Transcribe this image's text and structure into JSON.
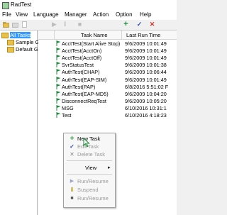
{
  "window": {
    "title": "RadTest"
  },
  "menu": [
    "File",
    "View",
    "Language",
    "Manager",
    "Action",
    "Option",
    "Help"
  ],
  "toolbar": {
    "icons": [
      "folder-icon",
      "folder-open-icon",
      "page-icon",
      "skip-icon",
      "pause-icon",
      "stop-icon",
      "add-icon",
      "check-icon",
      "delete-icon"
    ]
  },
  "tree": {
    "items": [
      {
        "label": "All Tasks",
        "selected": true
      },
      {
        "label": "Sample Group",
        "selected": false
      },
      {
        "label": "Default Group",
        "selected": false
      }
    ]
  },
  "list": {
    "columns": [
      "Task Name",
      "Last Run Time"
    ],
    "rows": [
      {
        "name": "AcctTest(Start Alive Stop)",
        "time": "9/6/2009 10:01:49"
      },
      {
        "name": "AcctTest(AcctOn)",
        "time": "9/6/2009 10:01:49"
      },
      {
        "name": "AcctTest(AcctOff)",
        "time": "9/6/2009 10:01:49"
      },
      {
        "name": "SvrStatusTest",
        "time": "9/6/2009 10:01:38"
      },
      {
        "name": "AuthTest(CHAP)",
        "time": "9/6/2009 10:06:44"
      },
      {
        "name": "AuthTest(EAP-SIM)",
        "time": "9/6/2009 10:01:49"
      },
      {
        "name": "AuthTest(PAP)",
        "time": "6/8/2016 5:51:02 F"
      },
      {
        "name": "AuthTest(EAP-MD5)",
        "time": "9/6/2009 10:04:20"
      },
      {
        "name": "DisconnectReqTest",
        "time": "9/6/2009 10:05:20"
      },
      {
        "name": "MSG",
        "time": "6/10/2016 10:31:1"
      },
      {
        "name": "Test",
        "time": "6/10/2016 4:18:23"
      }
    ]
  },
  "context_menu": {
    "items": [
      {
        "label": "New Task",
        "icon": "plus-icon",
        "enabled": true
      },
      {
        "label": "Edit Task",
        "icon": "check-icon",
        "enabled": false
      },
      {
        "label": "Delete Task",
        "icon": "x-icon",
        "enabled": false
      },
      {
        "label": "View",
        "icon": "",
        "enabled": true,
        "submenu": true
      },
      {
        "label": "Run/Resume",
        "icon": "play-icon",
        "enabled": false
      },
      {
        "label": "Suspend",
        "icon": "pause-icon",
        "enabled": false
      },
      {
        "label": "Run/Resume",
        "icon": "stop-icon",
        "enabled": false
      }
    ]
  },
  "colors": {
    "accent": "#1e8c3a",
    "selection": "#3399ff",
    "delete": "#d9332b",
    "edit": "#2d4fb3"
  }
}
